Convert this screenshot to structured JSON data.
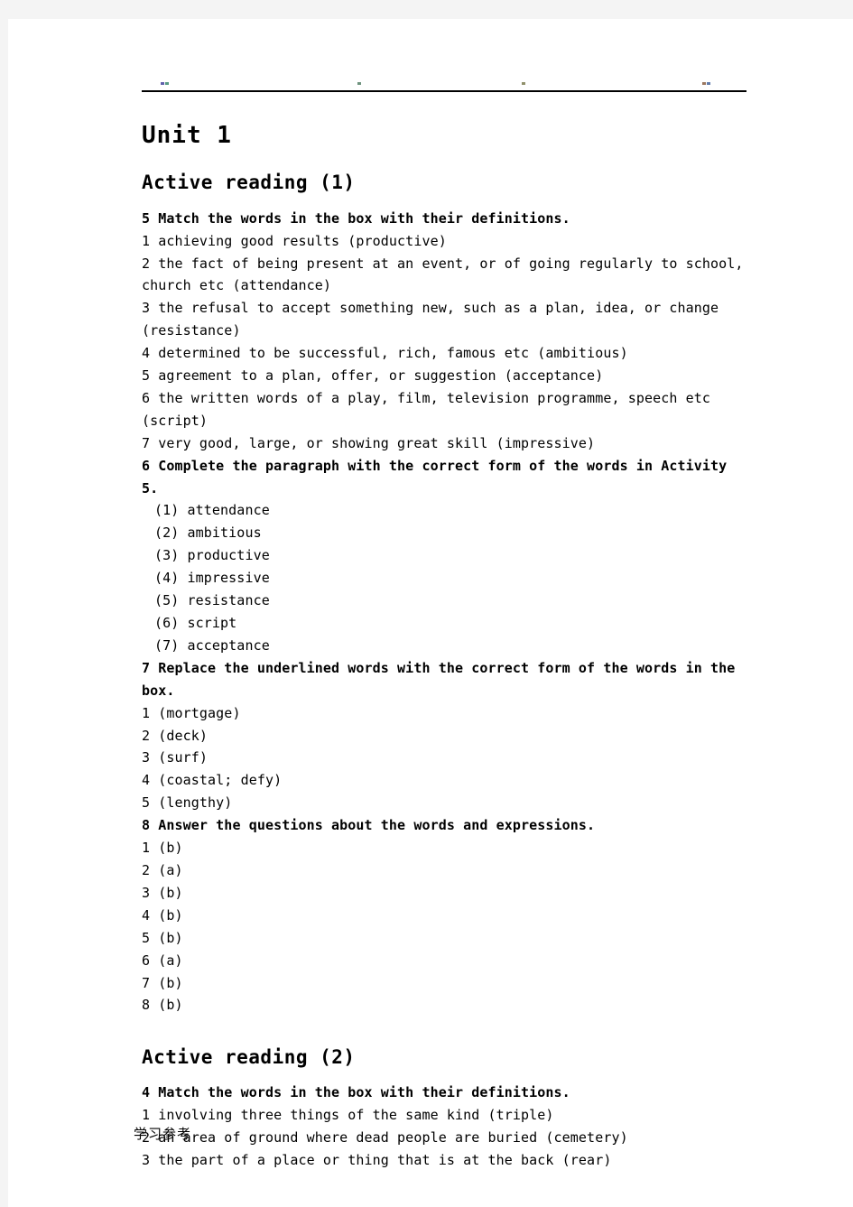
{
  "page": {
    "background_color": "#f4f4f4",
    "sheet_color": "#ffffff",
    "text_color": "#000000"
  },
  "header": {
    "rule_visible": true,
    "running_head_text": ""
  },
  "unit_title": "Unit 1",
  "sections": [
    {
      "title": "Active reading (1)",
      "lines": [
        {
          "text": "5 Match the words in the box with their definitions.",
          "bold": true,
          "indent": false
        },
        {
          "text": "1 achieving good results (productive)",
          "bold": false,
          "indent": false
        },
        {
          "text": "2 the fact of being present at an event, or of going regularly to school,",
          "bold": false,
          "indent": false
        },
        {
          "text": "church etc (attendance)",
          "bold": false,
          "indent": false
        },
        {
          "text": "3 the refusal to accept something new, such as a plan, idea, or change",
          "bold": false,
          "indent": false
        },
        {
          "text": "(resistance)",
          "bold": false,
          "indent": false
        },
        {
          "text": "4 determined to be successful, rich, famous etc (ambitious)",
          "bold": false,
          "indent": false
        },
        {
          "text": "5 agreement to a plan, offer, or suggestion (acceptance)",
          "bold": false,
          "indent": false
        },
        {
          "text": "6 the written words of a play, film, television programme, speech etc",
          "bold": false,
          "indent": false
        },
        {
          "text": "(script)",
          "bold": false,
          "indent": false
        },
        {
          "text": "7 very good, large, or showing great skill (impressive)",
          "bold": false,
          "indent": false
        },
        {
          "text": "6 Complete the paragraph with the correct form of the words in Activity 5.",
          "bold": true,
          "indent": false
        },
        {
          "text": "(1) attendance",
          "bold": false,
          "indent": true
        },
        {
          "text": "(2) ambitious",
          "bold": false,
          "indent": true
        },
        {
          "text": "(3) productive",
          "bold": false,
          "indent": true
        },
        {
          "text": "(4) impressive",
          "bold": false,
          "indent": true
        },
        {
          "text": "(5) resistance",
          "bold": false,
          "indent": true
        },
        {
          "text": "(6) script",
          "bold": false,
          "indent": true
        },
        {
          "text": "(7) acceptance",
          "bold": false,
          "indent": true
        },
        {
          "text": "7 Replace the underlined words with the correct form of the words in the box.",
          "bold": true,
          "indent": false
        },
        {
          "text": "1 (mortgage)",
          "bold": false,
          "indent": false
        },
        {
          "text": "2 (deck)",
          "bold": false,
          "indent": false
        },
        {
          "text": "3 (surf)",
          "bold": false,
          "indent": false
        },
        {
          "text": "4 (coastal; defy)",
          "bold": false,
          "indent": false
        },
        {
          "text": "5 (lengthy)",
          "bold": false,
          "indent": false
        },
        {
          "text": "8 Answer the questions about the words and expressions.",
          "bold": true,
          "indent": false
        },
        {
          "text": "1 (b)",
          "bold": false,
          "indent": false
        },
        {
          "text": "2 (a)",
          "bold": false,
          "indent": false
        },
        {
          "text": "3 (b)",
          "bold": false,
          "indent": false
        },
        {
          "text": "4 (b)",
          "bold": false,
          "indent": false
        },
        {
          "text": "5 (b)",
          "bold": false,
          "indent": false
        },
        {
          "text": "6 (a)",
          "bold": false,
          "indent": false
        },
        {
          "text": "7 (b)",
          "bold": false,
          "indent": false
        },
        {
          "text": "8 (b)",
          "bold": false,
          "indent": false
        }
      ]
    },
    {
      "title": "Active reading (2)",
      "lines": [
        {
          "text": "4 Match the words in the box with their definitions.",
          "bold": true,
          "indent": false
        },
        {
          "text": "1 involving three things of the same kind (triple)",
          "bold": false,
          "indent": false
        },
        {
          "text": "2 an area of ground where dead people are buried (cemetery)",
          "bold": false,
          "indent": false
        },
        {
          "text": "3 the part of a place or thing that is at the back (rear)",
          "bold": false,
          "indent": false
        }
      ]
    }
  ],
  "footer": {
    "note": "学习参考"
  }
}
